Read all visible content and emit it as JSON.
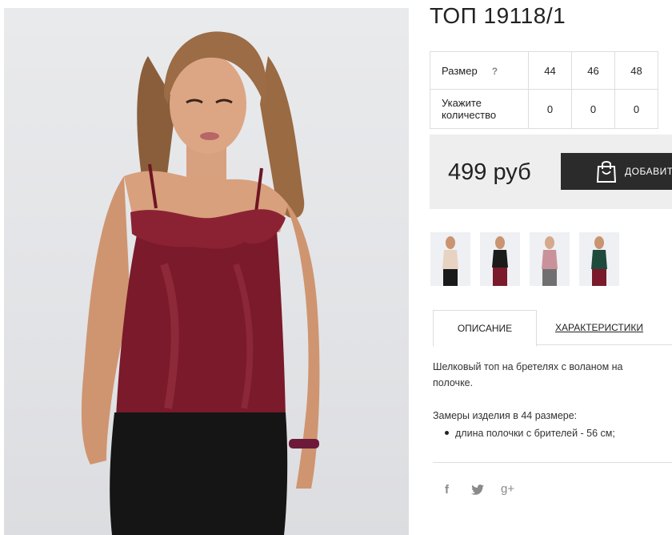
{
  "product": {
    "title": "ТОП 19118/1",
    "price": "499 руб",
    "add_button_label": "ДОБАВИТ"
  },
  "size_table": {
    "size_label": "Размер",
    "help_symbol": "?",
    "quantity_label_line1": "Укажите",
    "quantity_label_line2": "количество",
    "sizes": [
      "44",
      "46",
      "48"
    ],
    "quantities": [
      "0",
      "0",
      "0"
    ]
  },
  "tabs": {
    "description": "ОПИСАНИЕ",
    "characteristics": "ХАРАКТЕРИСТИКИ"
  },
  "description": {
    "text": "Шелковый топ на бретелях с воланом на полочке.",
    "measure_heading": "Замеры изделия в 44 размере:",
    "bullets": [
      "длина полочки с брителей - 56 см;"
    ]
  },
  "social": {
    "facebook": "f",
    "twitter": "twitter-bird",
    "googleplus": "g+"
  },
  "colors": {
    "top_burgundy": "#7a1a2a",
    "dark_button": "#2b2b2b",
    "price_bg": "#eeeeee"
  }
}
